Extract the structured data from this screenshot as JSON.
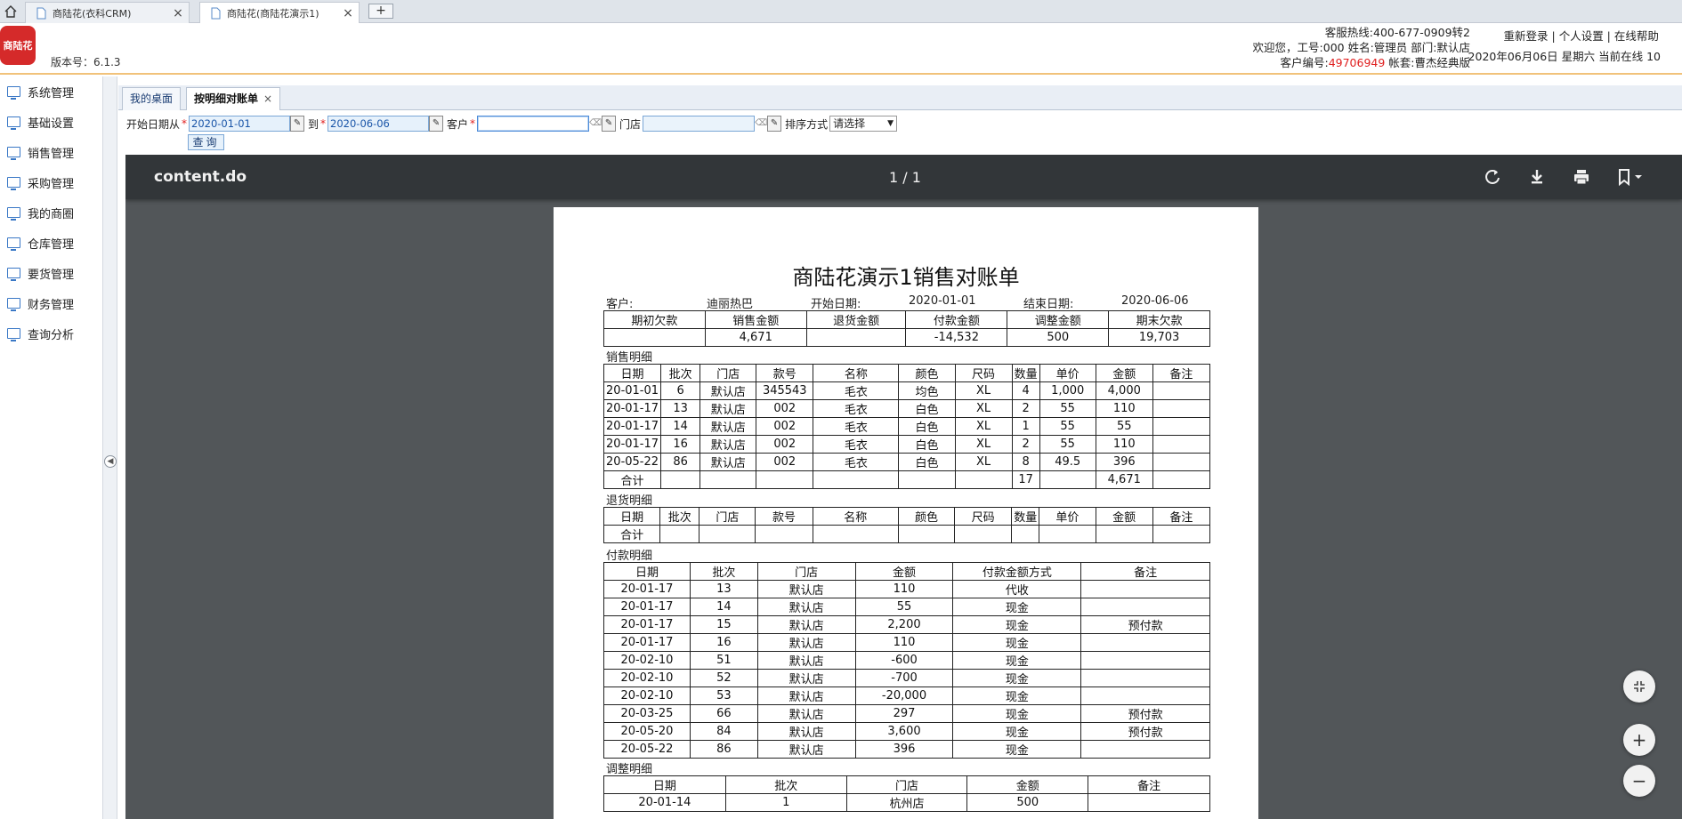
{
  "browser_tabs": [
    {
      "label": "商陆花(衣科CRM)"
    },
    {
      "label": "商陆花(商陆花演示1)"
    }
  ],
  "header": {
    "logo_text": "商陆花",
    "version": "版本号：6.1.3",
    "hotline": "客服热线:400-677-0909转2",
    "welcome": "欢迎您，工号:000 姓名:管理员 部门:默认店",
    "customer_prefix": "客户编号:",
    "customer_no": "49706949",
    "account": " 帐套:曹杰经典版",
    "links": "重新登录 | 个人设置 | 在线帮助",
    "date": "2020年06月06日 星期六 当前在线 10"
  },
  "sidebar": {
    "items": [
      {
        "label": "系统管理"
      },
      {
        "label": "基础设置"
      },
      {
        "label": "销售管理"
      },
      {
        "label": "采购管理"
      },
      {
        "label": "我的商圈"
      },
      {
        "label": "仓库管理"
      },
      {
        "label": "要货管理"
      },
      {
        "label": "财务管理"
      },
      {
        "label": "查询分析"
      }
    ]
  },
  "content_tabs": [
    {
      "label": "我的桌面"
    },
    {
      "label": "按明细对账单",
      "close": "×"
    }
  ],
  "filter": {
    "start_label": "开始日期从",
    "start_value": "2020-01-01",
    "to_label": "到",
    "end_value": "2020-06-06",
    "customer_label": "客户",
    "customer_value": "",
    "store_label": "门店",
    "store_value": "",
    "sort_label": "排序方式",
    "sort_value": "请选择",
    "required_mark": "*",
    "query_label": "查询"
  },
  "viewer": {
    "title": "content.do",
    "pages": "1 / 1",
    "icons": [
      "rotate-icon",
      "download-icon",
      "print-icon",
      "bookmark-icon",
      "fit-page-icon",
      "zoom-in-icon",
      "zoom-out-icon"
    ]
  },
  "report": {
    "title": "商陆花演示1销售对账单",
    "meta": {
      "customer_label": "客户:",
      "customer": "迪丽热巴",
      "start_label": "开始日期:",
      "start": "2020-01-01",
      "end_label": "结束日期:",
      "end": "2020-06-06"
    },
    "summary": {
      "headers": [
        "期初欠款",
        "销售金额",
        "退货金额",
        "付款金额",
        "调整金额",
        "期末欠款"
      ],
      "values": [
        "",
        "4,671",
        "",
        "-14,532",
        "500",
        "19,703"
      ]
    },
    "sales_title": "销售明细",
    "sales_headers": [
      "日期",
      "批次",
      "门店",
      "款号",
      "名称",
      "颜色",
      "尺码",
      "数量",
      "单价",
      "金额",
      "备注"
    ],
    "sales_rows": [
      [
        "20-01-01",
        "6",
        "默认店",
        "345543",
        "毛衣",
        "均色",
        "XL",
        "4",
        "1,000",
        "4,000",
        ""
      ],
      [
        "20-01-17",
        "13",
        "默认店",
        "002",
        "毛衣",
        "白色",
        "XL",
        "2",
        "55",
        "110",
        ""
      ],
      [
        "20-01-17",
        "14",
        "默认店",
        "002",
        "毛衣",
        "白色",
        "XL",
        "1",
        "55",
        "55",
        ""
      ],
      [
        "20-01-17",
        "16",
        "默认店",
        "002",
        "毛衣",
        "白色",
        "XL",
        "2",
        "55",
        "110",
        ""
      ],
      [
        "20-05-22",
        "86",
        "默认店",
        "002",
        "毛衣",
        "白色",
        "XL",
        "8",
        "49.5",
        "396",
        ""
      ]
    ],
    "sales_total": [
      "合计",
      "",
      "",
      "",
      "",
      "",
      "",
      "17",
      "",
      "4,671",
      ""
    ],
    "returns_title": "退货明细",
    "returns_headers": [
      "日期",
      "批次",
      "门店",
      "款号",
      "名称",
      "颜色",
      "尺码",
      "数量",
      "单价",
      "金额",
      "备注"
    ],
    "returns_total": [
      "合计",
      "",
      "",
      "",
      "",
      "",
      "",
      "",
      "",
      "",
      ""
    ],
    "payments_title": "付款明细",
    "payments_headers": [
      "日期",
      "批次",
      "门店",
      "金额",
      "付款金额方式",
      "备注"
    ],
    "payments_rows": [
      [
        "20-01-17",
        "13",
        "默认店",
        "110",
        "代收",
        ""
      ],
      [
        "20-01-17",
        "14",
        "默认店",
        "55",
        "现金",
        ""
      ],
      [
        "20-01-17",
        "15",
        "默认店",
        "2,200",
        "现金",
        "预付款"
      ],
      [
        "20-01-17",
        "16",
        "默认店",
        "110",
        "现金",
        ""
      ],
      [
        "20-02-10",
        "51",
        "默认店",
        "-600",
        "现金",
        ""
      ],
      [
        "20-02-10",
        "52",
        "默认店",
        "-700",
        "现金",
        ""
      ],
      [
        "20-02-10",
        "53",
        "默认店",
        "-20,000",
        "现金",
        ""
      ],
      [
        "20-03-25",
        "66",
        "默认店",
        "297",
        "现金",
        "预付款"
      ],
      [
        "20-05-20",
        "84",
        "默认店",
        "3,600",
        "现金",
        "预付款"
      ],
      [
        "20-05-22",
        "86",
        "默认店",
        "396",
        "现金",
        ""
      ]
    ],
    "adjust_title": "调整明细",
    "adjust_headers": [
      "日期",
      "批次",
      "门店",
      "金额",
      "备注"
    ],
    "adjust_rows": [
      [
        "20-01-14",
        "1",
        "杭州店",
        "500",
        ""
      ]
    ]
  },
  "colors": {
    "accent": "#3a78c6",
    "viewer_bg": "#525659",
    "viewer_toolbar": "#323639",
    "logo": "#d52a2a",
    "highlight": "#e02020"
  }
}
